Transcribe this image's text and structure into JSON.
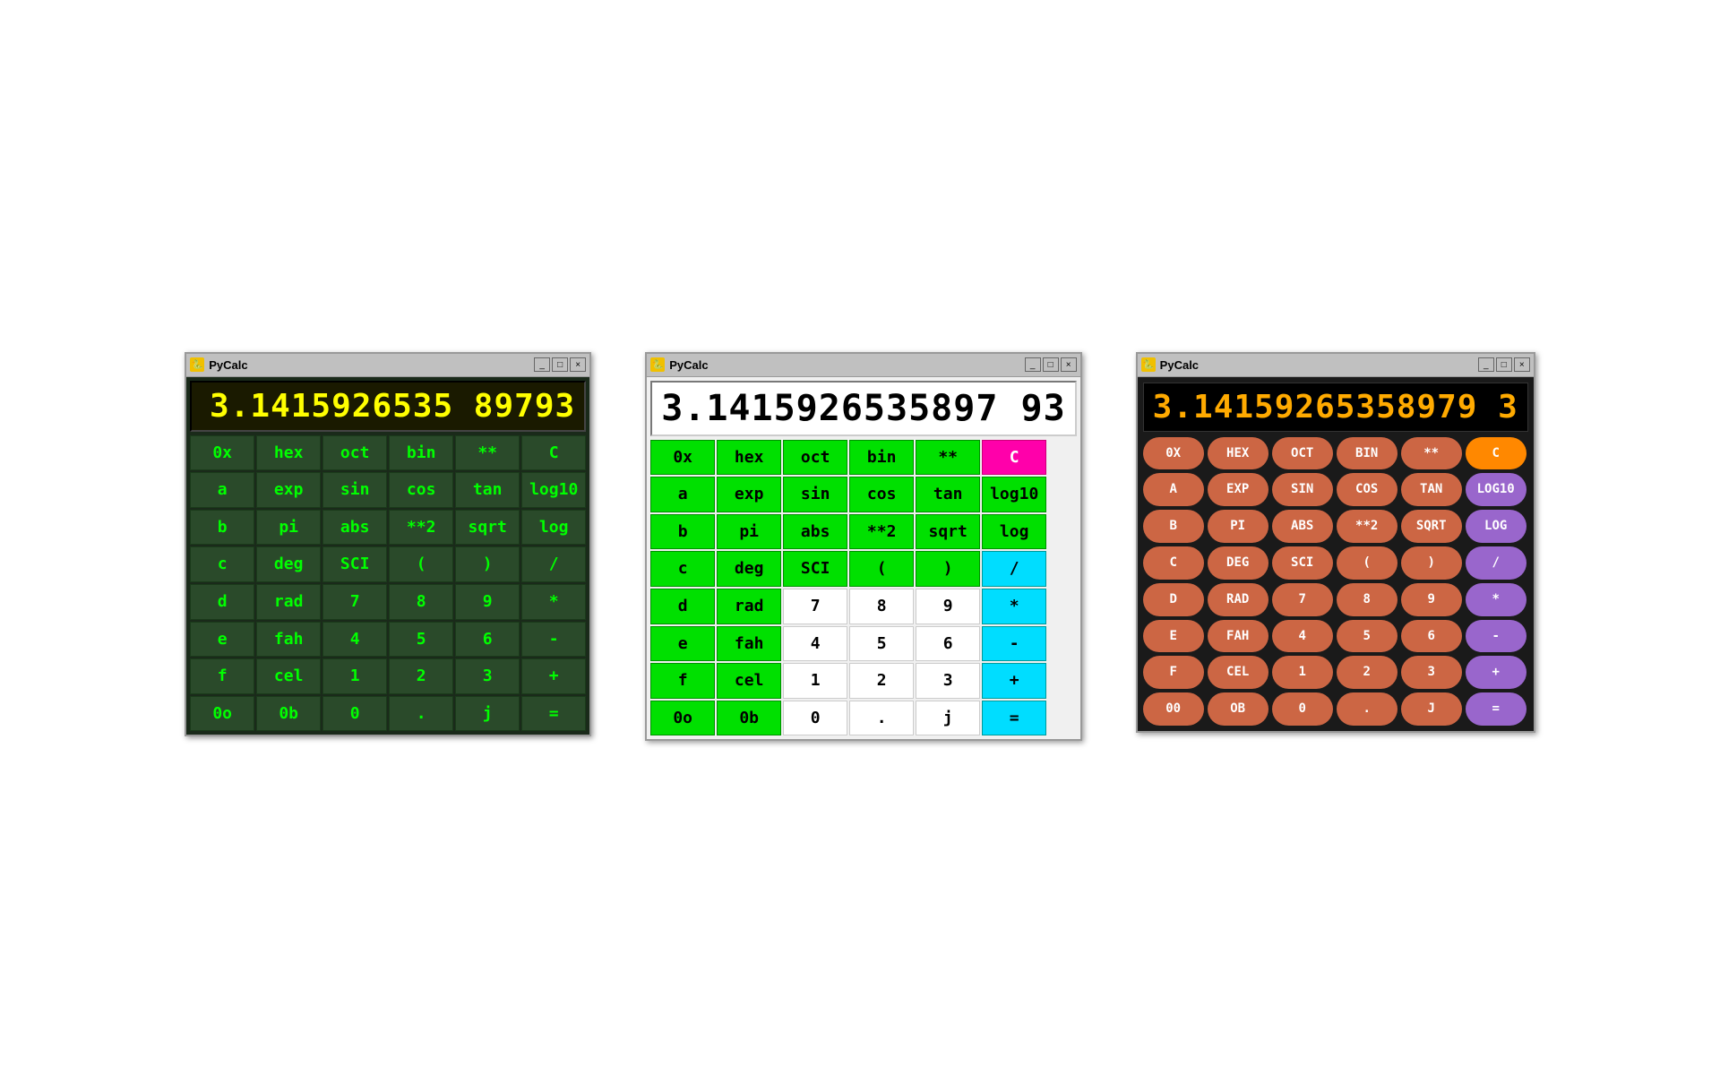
{
  "display_value": "3.14159265358979 3",
  "display_value2": "3.1415926535897 93",
  "display_value3": "3.14159265358979 3",
  "title": "PyCalc",
  "win_buttons": [
    "_",
    "□",
    "×"
  ],
  "calc1": {
    "display": "3.1415926535 89793",
    "buttons": [
      [
        "0x",
        "hex",
        "oct",
        "bin",
        "**",
        "C"
      ],
      [
        "a",
        "exp",
        "sin",
        "cos",
        "tan",
        "log10"
      ],
      [
        "b",
        "pi",
        "abs",
        "**2",
        "sqrt",
        "log"
      ],
      [
        "c",
        "deg",
        "SCI",
        "(",
        ")",
        "/"
      ],
      [
        "d",
        "rad",
        "7",
        "8",
        "9",
        "*"
      ],
      [
        "e",
        "fah",
        "4",
        "5",
        "6",
        "-"
      ],
      [
        "f",
        "cel",
        "1",
        "2",
        "3",
        "+"
      ],
      [
        "0o",
        "0b",
        "0",
        ".",
        "j",
        "="
      ]
    ]
  },
  "calc2": {
    "display": "3.1415926535897 93",
    "buttons": [
      [
        "0x",
        "hex",
        "oct",
        "bin",
        "**",
        "C"
      ],
      [
        "a",
        "exp",
        "sin",
        "cos",
        "tan",
        "log10"
      ],
      [
        "b",
        "pi",
        "abs",
        "**2",
        "sqrt",
        "log"
      ],
      [
        "c",
        "deg",
        "SCI",
        "(",
        ")",
        "/"
      ],
      [
        "d",
        "rad",
        "7",
        "8",
        "9",
        "*"
      ],
      [
        "e",
        "fah",
        "4",
        "5",
        "6",
        "-"
      ],
      [
        "f",
        "cel",
        "1",
        "2",
        "3",
        "+"
      ],
      [
        "0o",
        "0b",
        "0",
        ".",
        "j",
        "="
      ]
    ]
  },
  "calc3": {
    "display": "3.14159265358979 3",
    "buttons": [
      [
        "0X",
        "HEX",
        "OCT",
        "BIN",
        "**",
        "C"
      ],
      [
        "A",
        "EXP",
        "SIN",
        "COS",
        "TAN",
        "LOG10"
      ],
      [
        "B",
        "PI",
        "ABS",
        "**2",
        "SQRT",
        "LOG"
      ],
      [
        "C",
        "DEG",
        "SCI",
        "(",
        ")",
        "/"
      ],
      [
        "D",
        "RAD",
        "7",
        "8",
        "9",
        "*"
      ],
      [
        "E",
        "FAH",
        "4",
        "5",
        "6",
        "-"
      ],
      [
        "F",
        "CEL",
        "1",
        "2",
        "3",
        "+"
      ],
      [
        "00",
        "OB",
        "0",
        ".",
        "J",
        "="
      ]
    ]
  }
}
